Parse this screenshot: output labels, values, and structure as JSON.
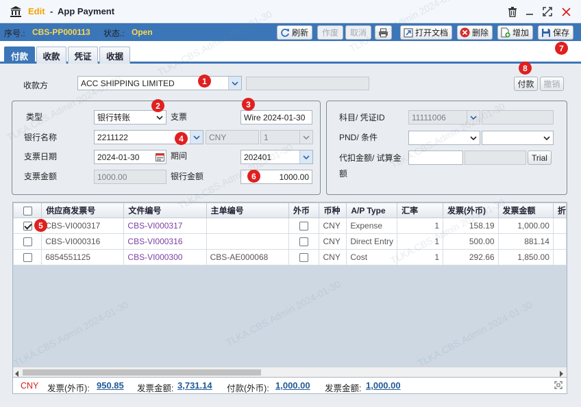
{
  "title": {
    "mode": "Edit",
    "separator": "-",
    "name": "App Payment"
  },
  "status": {
    "seq_label": "序号.:",
    "seq_value": "CBS-PP000113",
    "state_label": "状态.:",
    "state_value": "Open"
  },
  "actions": {
    "refresh": "刷新",
    "void": "作废",
    "cancel": "取消",
    "open_doc": "打开文档",
    "delete": "删除",
    "add": "增加",
    "save": "保存"
  },
  "tabs": [
    "付款",
    "收款",
    "凭证",
    "收据"
  ],
  "payee": {
    "label": "收款方",
    "value": "ACC SHIPPING LIMITED",
    "extra": ""
  },
  "top_buttons": {
    "pay": "付款",
    "revoke": "撤销"
  },
  "form": {
    "type_label": "类型",
    "type_value": "银行转账",
    "cheque_label": "支票",
    "cheque_value": "Wire 2024-01-30",
    "bank_label": "银行名称",
    "bank_value": "2211122",
    "currency": "CNY",
    "rate": "1",
    "date_label": "支票日期",
    "date_value": "2024-01-30",
    "period_label": "期间",
    "period_value": "202401",
    "cheque_amount_label": "支票金额",
    "cheque_amount_value": "1000.00",
    "bank_amount_label": "银行金额",
    "bank_amount_value": "1000.00"
  },
  "side": {
    "account_label": "科目/ 凭证ID",
    "account_value": "11111006",
    "account_extra": "",
    "pnd_label": "PND/  条件",
    "pnd_value": "",
    "cond_value": "",
    "withhold_label_1": "代扣金额/ 试算金",
    "withhold_label_2": "额",
    "withhold_value": "",
    "trial_value": "",
    "trial_button": "Trial"
  },
  "grid": {
    "columns": [
      "供应商发票号",
      "文件编号",
      "主单编号",
      "外币",
      "币种",
      "A/P Type",
      "汇率",
      "发票(外币)",
      "发票金额",
      "折"
    ],
    "rows": [
      {
        "checked": true,
        "vendor_invoice": "CBS-VI000317",
        "file_no": "CBS-VI000317",
        "master_no": "",
        "foreign": false,
        "currency": "CNY",
        "ap_type": "Expense",
        "rate": "1",
        "invoice_fc": "158.19",
        "invoice_amount": "1,000.00"
      },
      {
        "checked": false,
        "vendor_invoice": "CBS-VI000316",
        "file_no": "CBS-VI000316",
        "master_no": "",
        "foreign": false,
        "currency": "CNY",
        "ap_type": "Direct Entry",
        "rate": "1",
        "invoice_fc": "500.00",
        "invoice_amount": "881.14"
      },
      {
        "checked": false,
        "vendor_invoice": "6854551125",
        "file_no": "CBS-VI000300",
        "master_no": "CBS-AE000068",
        "foreign": false,
        "currency": "CNY",
        "ap_type": "Cost",
        "rate": "1",
        "invoice_fc": "292.66",
        "invoice_amount": "1,850.00"
      }
    ]
  },
  "footer": {
    "currency": "CNY",
    "invoice_fc_label": "发票(外币):",
    "invoice_fc_value": "950.85",
    "invoice_amount_label": "发票金额:",
    "invoice_amount_value": "3,731.14",
    "payment_fc_label": "付款(外币):",
    "payment_fc_value": "1,000.00",
    "invoice_amount2_label": "发票金额:",
    "invoice_amount2_value": "1,000.00"
  },
  "badges": [
    "1",
    "2",
    "3",
    "4",
    "5",
    "6",
    "7",
    "8"
  ],
  "watermark": "TLKA.CBS.Admin 2024-01-30",
  "colors": {
    "brand": "#3b76b8",
    "accent": "#f5a300",
    "status_value": "#ffd84a",
    "badge": "#e02020",
    "link": "#7b3ea3",
    "total": "#1f5a96"
  }
}
